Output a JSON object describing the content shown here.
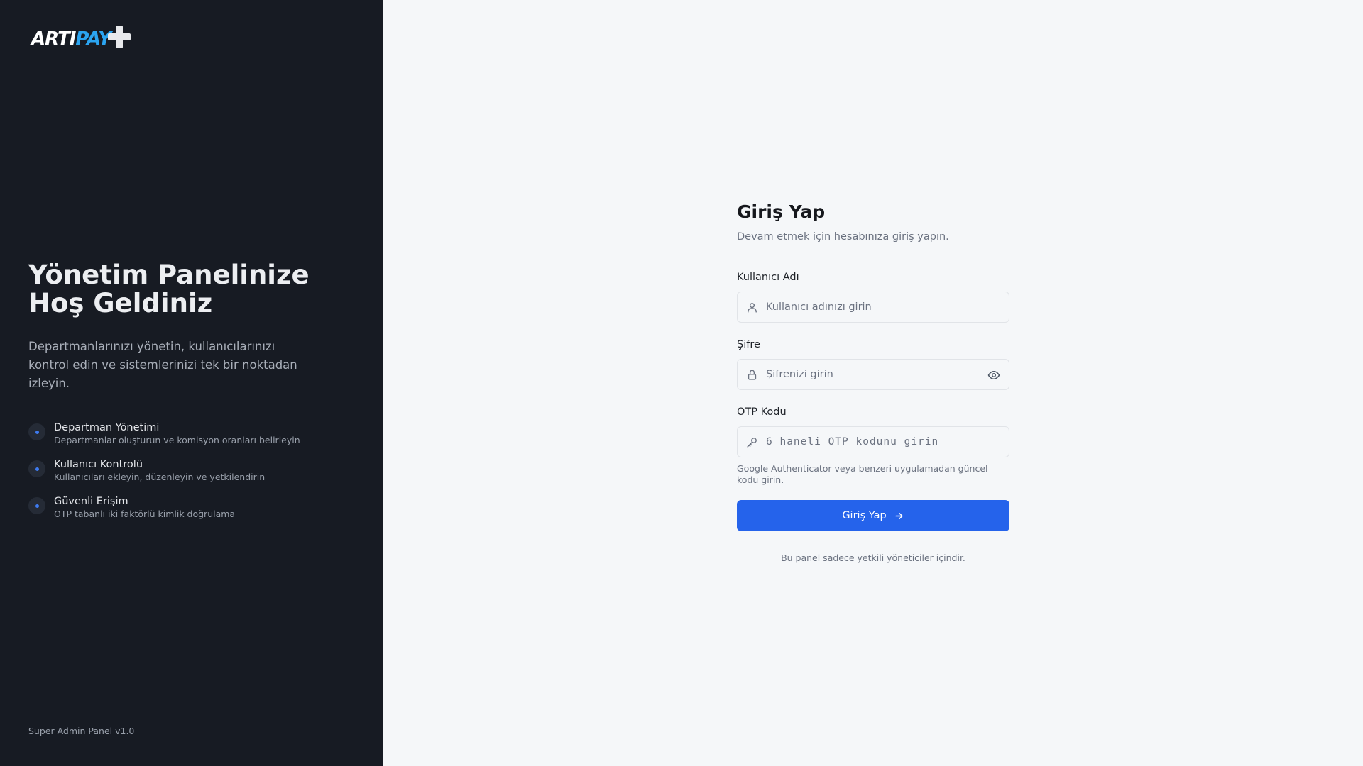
{
  "sidebar": {
    "logo": {
      "part1": "ARTI",
      "part2": "PAY"
    },
    "title": "Yönetim Panelinize Hoş Geldiniz",
    "description": "Departmanlarınızı yönetin, kullanıcılarınızı kontrol edin ve sistemlerinizi tek bir noktadan izleyin.",
    "features": [
      {
        "title": "Departman Yönetimi",
        "subtitle": "Departmanlar oluşturun ve komisyon oranları belirleyin"
      },
      {
        "title": "Kullanıcı Kontrolü",
        "subtitle": "Kullanıcıları ekleyin, düzenleyin ve yetkilendirin"
      },
      {
        "title": "Güvenli Erişim",
        "subtitle": "OTP tabanlı iki faktörlü kimlik doğrulama"
      }
    ],
    "version": "Super Admin Panel v1.0"
  },
  "form": {
    "title": "Giriş Yap",
    "subtitle": "Devam etmek için hesabınıza giriş yapın.",
    "username": {
      "label": "Kullanıcı Adı",
      "placeholder": "Kullanıcı adınızı girin",
      "value": ""
    },
    "password": {
      "label": "Şifre",
      "placeholder": "Şifrenizi girin",
      "value": ""
    },
    "otp": {
      "label": "OTP Kodu",
      "placeholder": "6 haneli OTP kodunu girin",
      "value": "",
      "hint": "Google Authenticator veya benzeri uygulamadan güncel kodu girin."
    },
    "submit_label": "Giriş Yap",
    "footer_note": "Bu panel sadece yetkili yöneticiler içindir."
  },
  "colors": {
    "sidebar_bg": "#171b23",
    "accent": "#2563eb",
    "logo_accent": "#2ba4f0",
    "page_bg": "#f5f7f9"
  },
  "icons": {
    "username": "user-icon",
    "password": "lock-icon",
    "toggle": "eye-icon",
    "otp": "key-icon",
    "submit": "arrow-right-icon"
  }
}
